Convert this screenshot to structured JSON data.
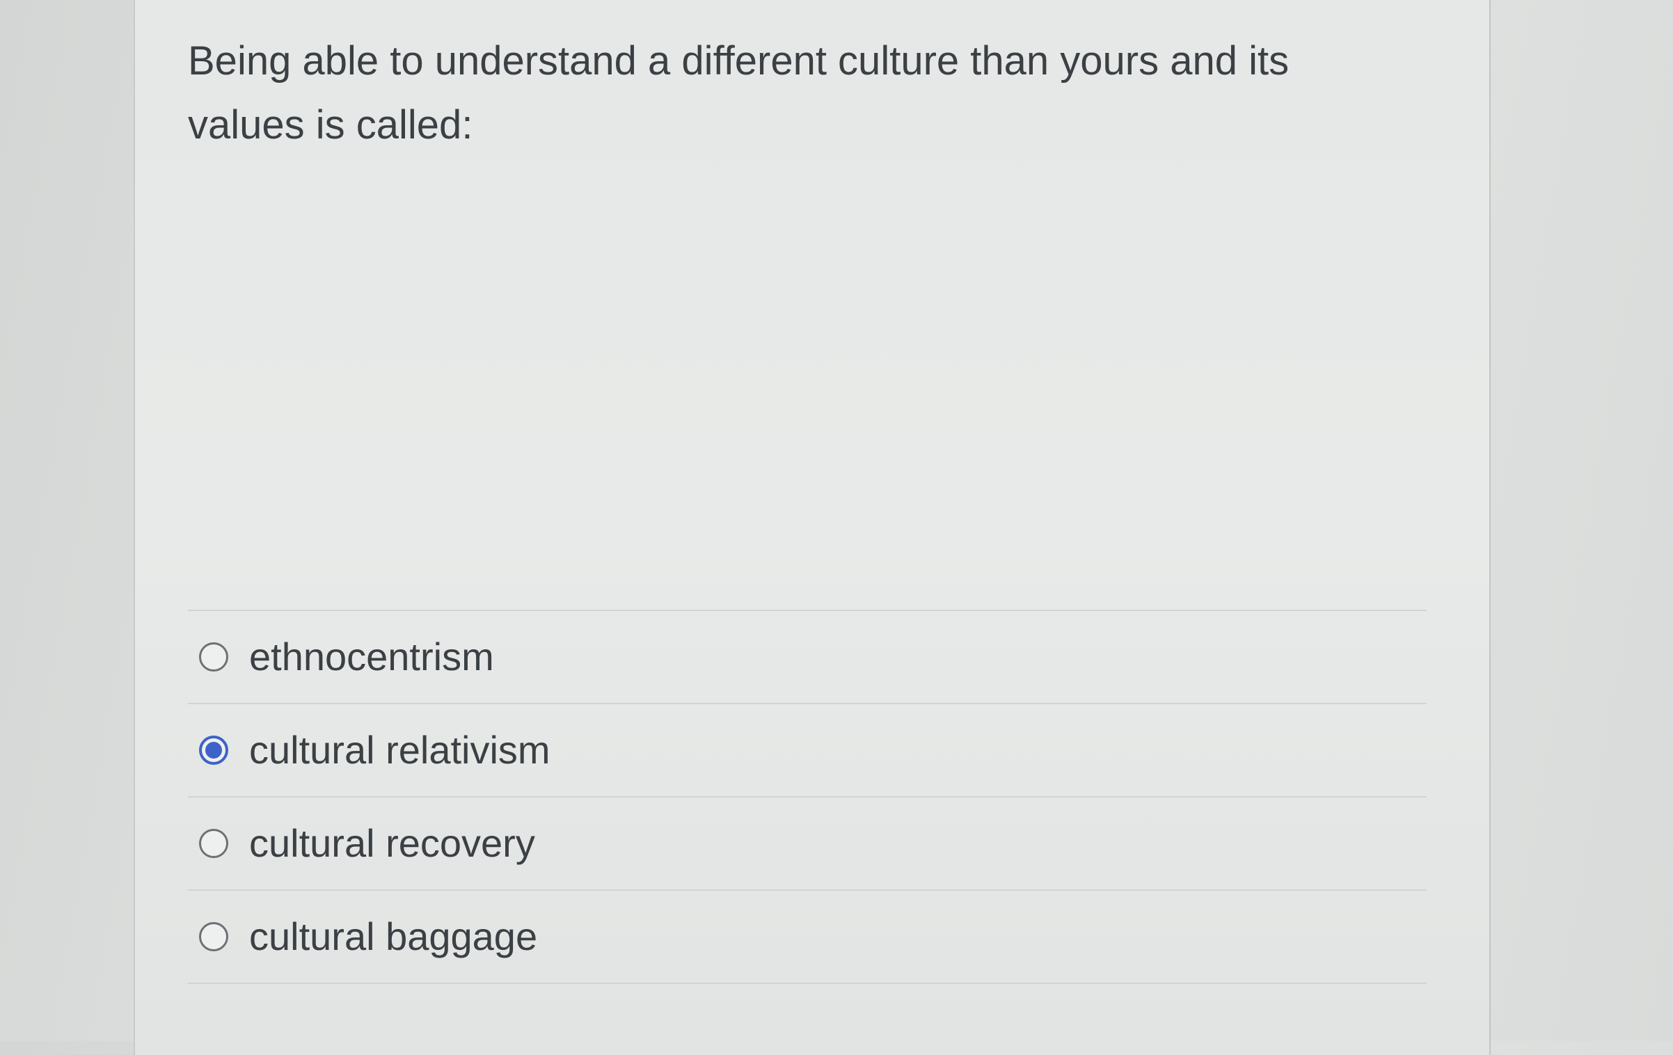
{
  "question": {
    "text": "Being able to understand a different culture than yours and its values is called:"
  },
  "options": [
    {
      "label": "ethnocentrism",
      "selected": false
    },
    {
      "label": "cultural relativism",
      "selected": true
    },
    {
      "label": "cultural recovery",
      "selected": false
    },
    {
      "label": "cultural baggage",
      "selected": false
    }
  ],
  "colors": {
    "selected_radio": "#3d63c8",
    "text": "#3b4044"
  }
}
